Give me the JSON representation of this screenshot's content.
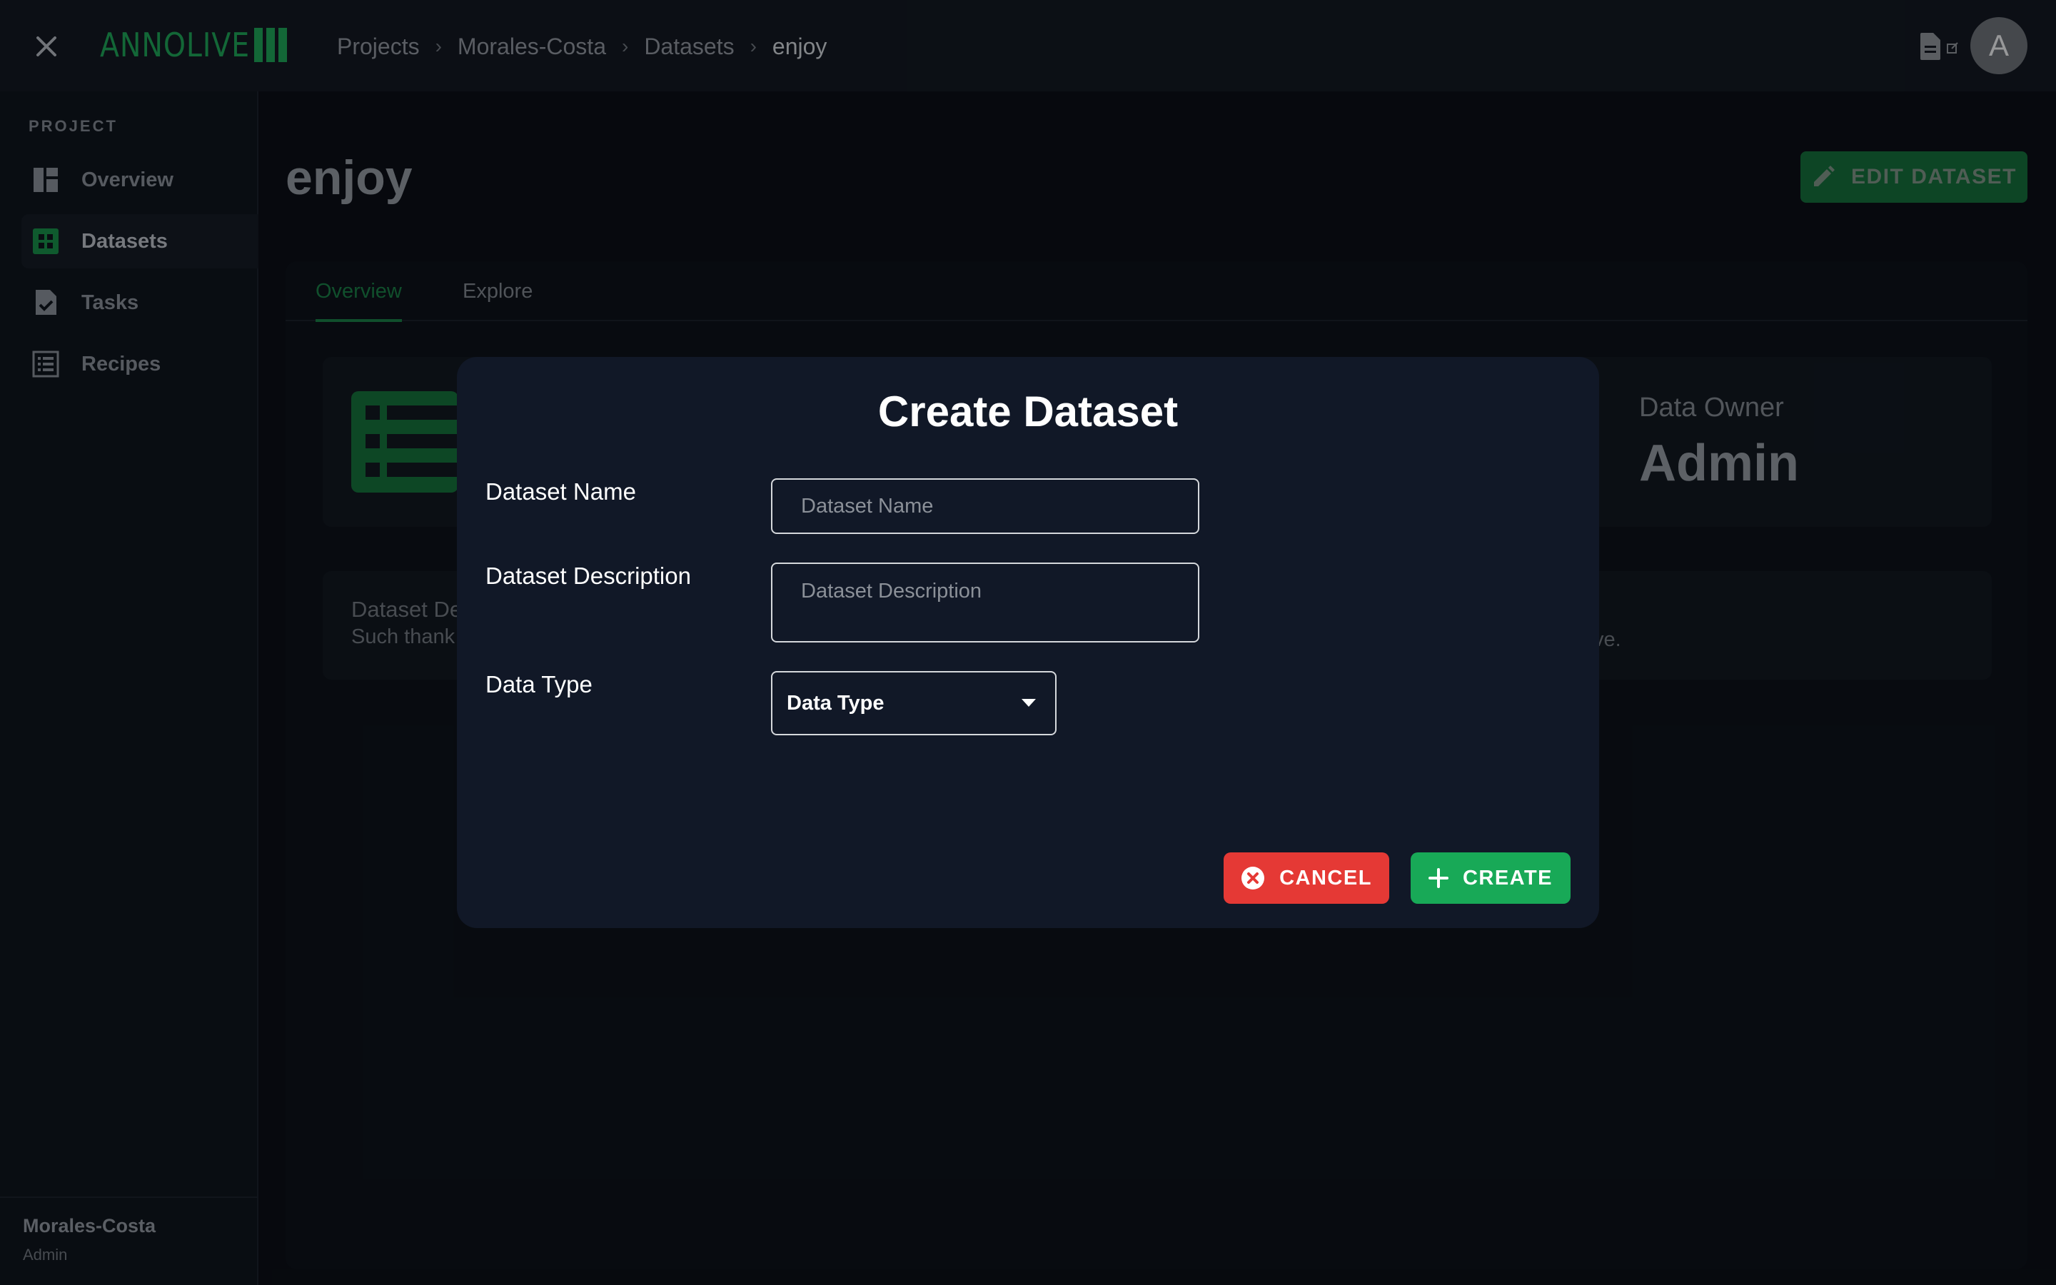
{
  "app": {
    "logo_text": "ANNOLIVE"
  },
  "breadcrumb": {
    "items": [
      "Projects",
      "Morales-Costa",
      "Datasets"
    ],
    "current": "enjoy",
    "separator": "›"
  },
  "user": {
    "avatar_initial": "A"
  },
  "sidebar": {
    "section_label": "PROJECT",
    "items": [
      {
        "label": "Overview",
        "icon": "dashboard-icon"
      },
      {
        "label": "Datasets",
        "icon": "grid-table-icon",
        "active": true
      },
      {
        "label": "Tasks",
        "icon": "task-check-icon"
      },
      {
        "label": "Recipes",
        "icon": "list-icon"
      }
    ],
    "footer": {
      "org": "Morales-Costa",
      "role": "Admin"
    }
  },
  "main": {
    "title": "enjoy",
    "edit_button": "EDIT DATASET",
    "tabs": [
      {
        "label": "Overview",
        "active": true
      },
      {
        "label": "Explore"
      }
    ],
    "info": {
      "owner_label": "Data Owner",
      "owner_value": "Admin"
    },
    "description": {
      "label_visible": "Dataset De",
      "text_visible": "Such thank",
      "tail_visible": "ve."
    }
  },
  "modal": {
    "title": "Create Dataset",
    "fields": {
      "name": {
        "label": "Dataset Name",
        "placeholder": "Dataset Name",
        "value": ""
      },
      "description": {
        "label": "Dataset Description",
        "placeholder": "Dataset Description",
        "value": ""
      },
      "data_type": {
        "label": "Data Type",
        "selected": "Data Type"
      }
    },
    "cancel_label": "CANCEL",
    "create_label": "CREATE"
  },
  "colors": {
    "brand_green": "#1e9e55",
    "cancel_red": "#e53935",
    "create_green": "#18a957",
    "background": "#0b0f16"
  }
}
